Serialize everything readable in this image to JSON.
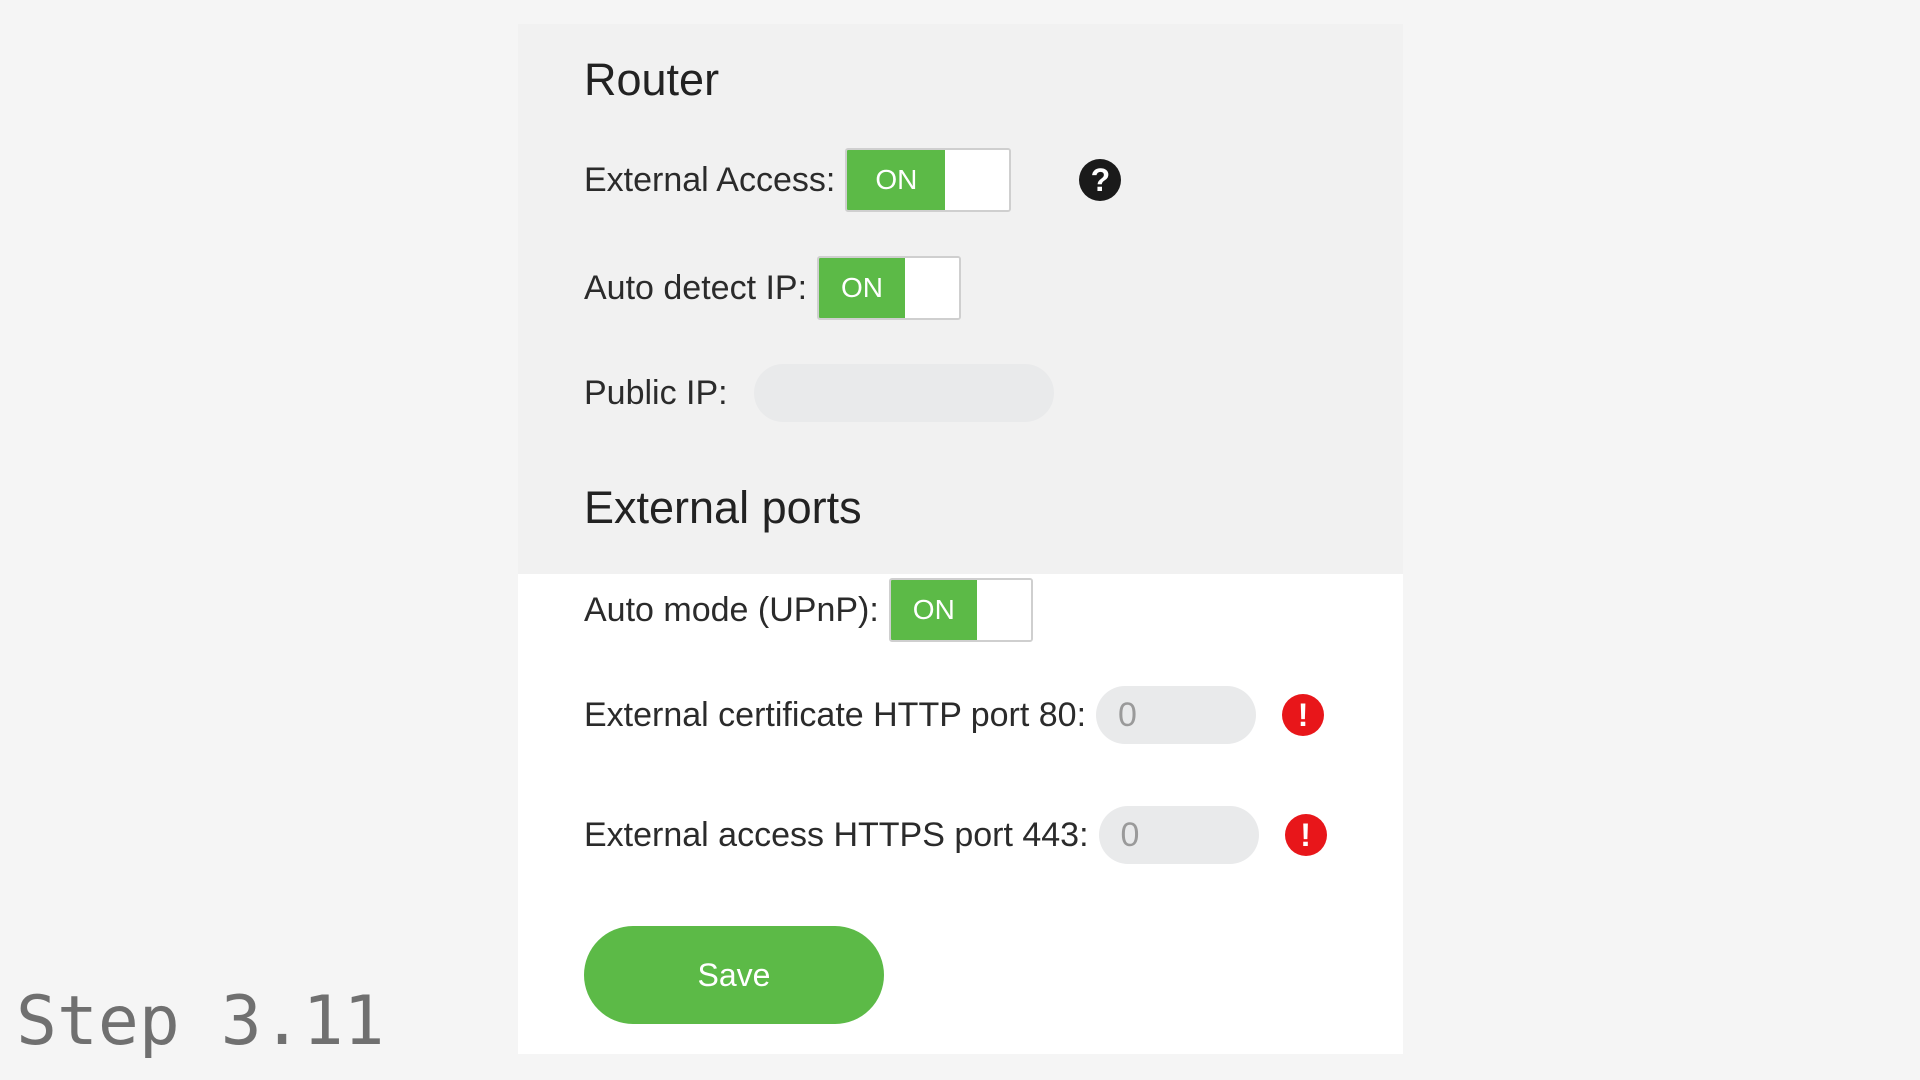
{
  "router": {
    "title": "Router",
    "external_access": {
      "label": "External Access:",
      "state": "ON"
    },
    "auto_detect_ip": {
      "label": "Auto detect IP:",
      "state": "ON"
    },
    "public_ip": {
      "label": "Public IP:",
      "value": ""
    },
    "help_icon": "question-circle-icon"
  },
  "external_ports": {
    "title": "External ports",
    "auto_mode": {
      "label": "Auto mode (UPnP):",
      "state": "ON"
    },
    "http_port": {
      "label": "External certificate HTTP port 80:",
      "value": "0"
    },
    "https_port": {
      "label": "External access HTTPS port 443:",
      "value": "0"
    },
    "warning_icon": "exclamation-circle-icon",
    "warning_color": "#e8161a"
  },
  "save_label": "Save",
  "step_label": "Step 3.11",
  "colors": {
    "accent": "#5cba47",
    "background": "#f5f5f5",
    "panel": "#ffffff"
  }
}
